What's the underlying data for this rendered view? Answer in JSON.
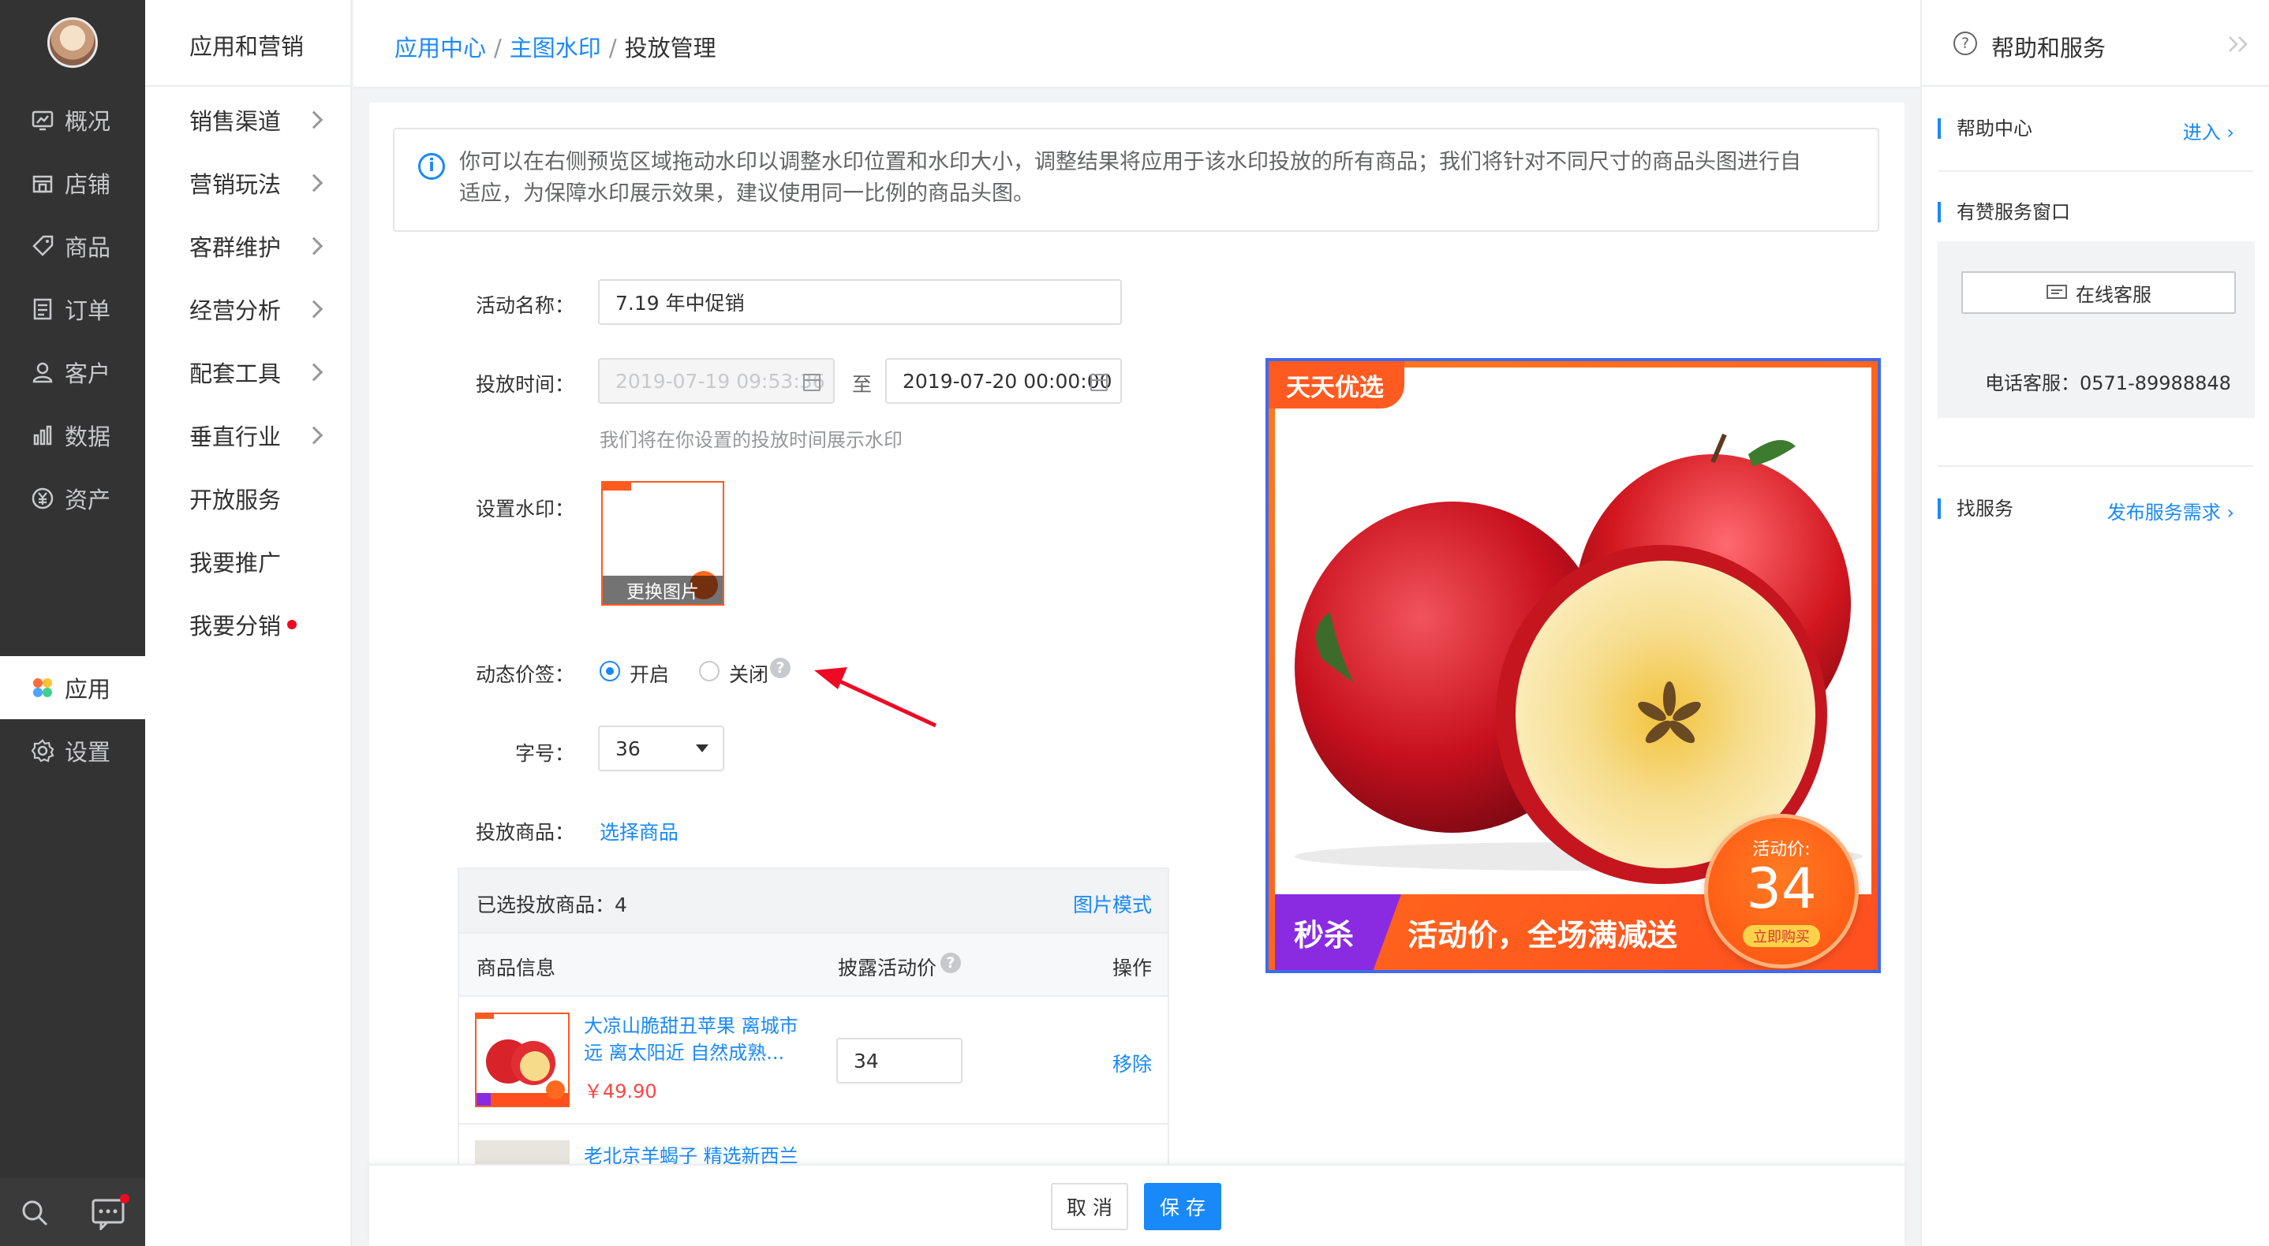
{
  "nav_primary": {
    "items": [
      {
        "label": "概况",
        "icon": "dashboard-icon"
      },
      {
        "label": "店铺",
        "icon": "store-icon"
      },
      {
        "label": "商品",
        "icon": "tag-icon"
      },
      {
        "label": "订单",
        "icon": "order-icon"
      },
      {
        "label": "客户",
        "icon": "user-icon"
      },
      {
        "label": "数据",
        "icon": "bar-chart-icon"
      },
      {
        "label": "资产",
        "icon": "yuan-icon"
      },
      {
        "label": "应用",
        "icon": "apps-icon",
        "active": true
      },
      {
        "label": "设置",
        "icon": "gear-icon"
      }
    ]
  },
  "nav_secondary": {
    "title": "应用和营销",
    "items": [
      {
        "label": "销售渠道",
        "has_arrow": true
      },
      {
        "label": "营销玩法",
        "has_arrow": true
      },
      {
        "label": "客群维护",
        "has_arrow": true
      },
      {
        "label": "经营分析",
        "has_arrow": true
      },
      {
        "label": "配套工具",
        "has_arrow": true
      },
      {
        "label": "垂直行业",
        "has_arrow": true
      },
      {
        "label": "开放服务",
        "has_arrow": false
      },
      {
        "label": "我要推广",
        "has_arrow": false
      },
      {
        "label": "我要分销",
        "has_arrow": false,
        "badge_dot": true
      }
    ]
  },
  "breadcrumb": {
    "level1": "应用中心",
    "level2": "主图水印",
    "current": "投放管理",
    "separator": "/"
  },
  "notice": {
    "line1": "你可以在右侧预览区域拖动水印以调整水印位置和水印大小，调整结果将应用于该水印投放的所有商品；我们将针对不同尺寸的商品头图进行自",
    "line2": "适应，为保障水印展示效果，建议使用同一比例的商品头图。"
  },
  "form": {
    "name_label": "活动名称：",
    "name_value": "7.19 年中促销",
    "time_label": "投放时间：",
    "time_start": "2019-07-19 09:53:36",
    "time_to": "至",
    "time_end": "2019-07-20 00:00:00",
    "time_hint": "我们将在你设置的投放时间展示水印",
    "watermark_label": "设置水印：",
    "watermark_change": "更换图片",
    "dynamic_label": "动态价签：",
    "dynamic_on": "开启",
    "dynamic_off": "关闭",
    "dynamic_selected": "开启",
    "fontsize_label": "字号：",
    "fontsize_value": "36",
    "goods_label": "投放商品：",
    "goods_select": "选择商品"
  },
  "goods_table": {
    "selected_label": "已选投放商品：",
    "selected_count": "4",
    "mode_link": "图片模式",
    "columns": [
      "商品信息",
      "披露活动价",
      "操作"
    ],
    "rows": [
      {
        "title_line1": "大凉山脆甜丑苹果 离城市",
        "title_line2": "远 离太阳近 自然成熟...",
        "price": "￥49.90",
        "activity_price": "34",
        "action": "移除"
      },
      {
        "title_line1": "老北京羊蝎子 精选新西兰",
        "title_line2": "",
        "price": "",
        "activity_price": "",
        "action": ""
      }
    ]
  },
  "preview": {
    "corner_tag": "天天优选",
    "banner_left": "秒杀",
    "banner_right": "活动价，全场满减送",
    "price_label": "活动价:",
    "price_value": "34",
    "buy_button": "立即购买"
  },
  "actions": {
    "cancel": "取 消",
    "save": "保 存"
  },
  "help_panel": {
    "title": "帮助和服务",
    "help_center": "帮助中心",
    "enter_link": "进入",
    "service_window": "有赞服务窗口",
    "online_service": "在线客服",
    "phone_label": "电话客服：",
    "phone": "0571-89988848",
    "find_service": "找服务",
    "publish_need": "发布服务需求"
  },
  "colors": {
    "accent": "#1989fa",
    "sidebar_dark": "#333333",
    "watermark_orange": "#ff5a1f",
    "banner_purple": "#8a2be2",
    "preview_border": "#3c6bf0",
    "annotation_red": "#ee0a24"
  }
}
